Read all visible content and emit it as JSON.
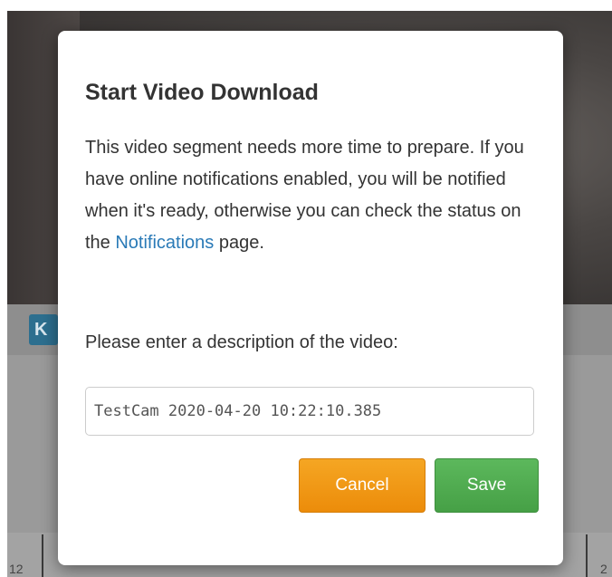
{
  "background": {
    "toolbar_button_label": "K",
    "timeline_left_label": "12",
    "timeline_right_label": "2"
  },
  "dialog": {
    "title": "Start Video Download",
    "message_before_link": "This video segment needs more time to prepare. If you have online notifications enabled, you will be notified when it's ready, otherwise you can check the status on the ",
    "link_label": "Notifications",
    "message_after_link": " page.",
    "prompt": "Please enter a description of the video:",
    "description_value": "TestCam 2020-04-20 10:22:10.385",
    "cancel_label": "Cancel",
    "save_label": "Save"
  },
  "colors": {
    "link": "#2a7ab7",
    "cancel_button": "#f0951a",
    "save_button": "#4cae4c"
  }
}
